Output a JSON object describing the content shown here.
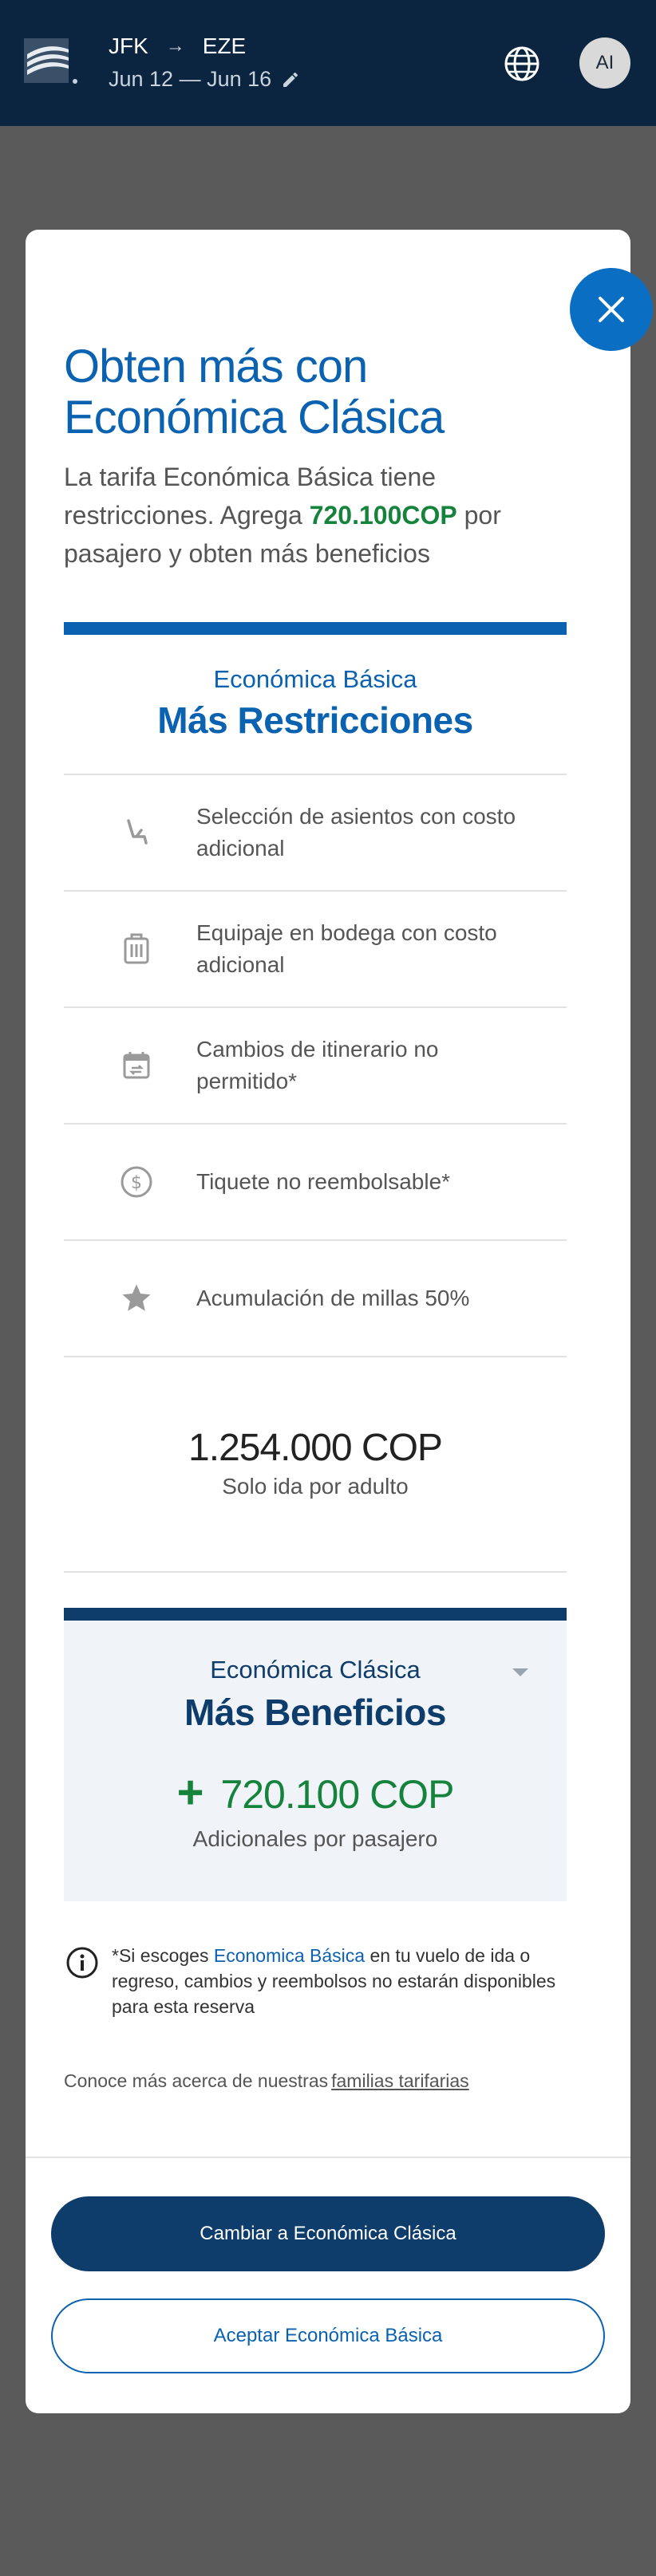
{
  "header": {
    "origin": "JFK",
    "arrow": "→",
    "destination": "EZE",
    "dates": "Jun 12 — Jun 16",
    "avatar_initials": "AI"
  },
  "modal": {
    "title_line1": "Obten más con",
    "title_line2": "Económica Clásica",
    "subtitle_before": "La tarifa Económica Básica tiene restricciones. Agrega ",
    "subtitle_amount": "720.100COP",
    "subtitle_after": " por pasajero y obten más beneficios",
    "basic": {
      "fare_name": "Económica Básica",
      "fare_tagline": "Más Restricciones",
      "features": [
        {
          "icon": "seat-icon",
          "text": "Selección de asientos con costo adicional"
        },
        {
          "icon": "luggage-icon",
          "text": "Equipaje en bodega con costo adicional"
        },
        {
          "icon": "calendar-change-icon",
          "text": "Cambios de itinerario no permitido*"
        },
        {
          "icon": "dollar-circle-icon",
          "text": "Tiquete no reembolsable*"
        },
        {
          "icon": "star-icon",
          "text": "Acumulación de millas 50%"
        }
      ],
      "price": "1.254.000 COP",
      "price_note": "Solo ida por adulto"
    },
    "classic": {
      "fare_name": "Económica Clásica",
      "fare_tagline": "Más Beneficios",
      "plus": "+",
      "extra_price": "720.100 COP",
      "extra_note": "Adicionales por pasajero"
    },
    "notice": {
      "before": "*Si escoges ",
      "link": "Economica Básica",
      "after": " en tu vuelo de ida o regreso, cambios y reembolsos no estarán disponibles para esta reserva"
    },
    "learn_more": {
      "text": "Conoce más acerca de nuestras",
      "link": "familias tarifarias"
    },
    "buttons": {
      "primary": "Cambiar a Económica Clásica",
      "secondary": "Aceptar Económica Básica"
    }
  },
  "colors": {
    "header_bg": "#0b2540",
    "primary_blue": "#0a62b0",
    "dark_navy": "#0e3c6b",
    "green": "#15833c",
    "close_button": "#0a6ec3",
    "overlay": "#5a5a5a"
  }
}
